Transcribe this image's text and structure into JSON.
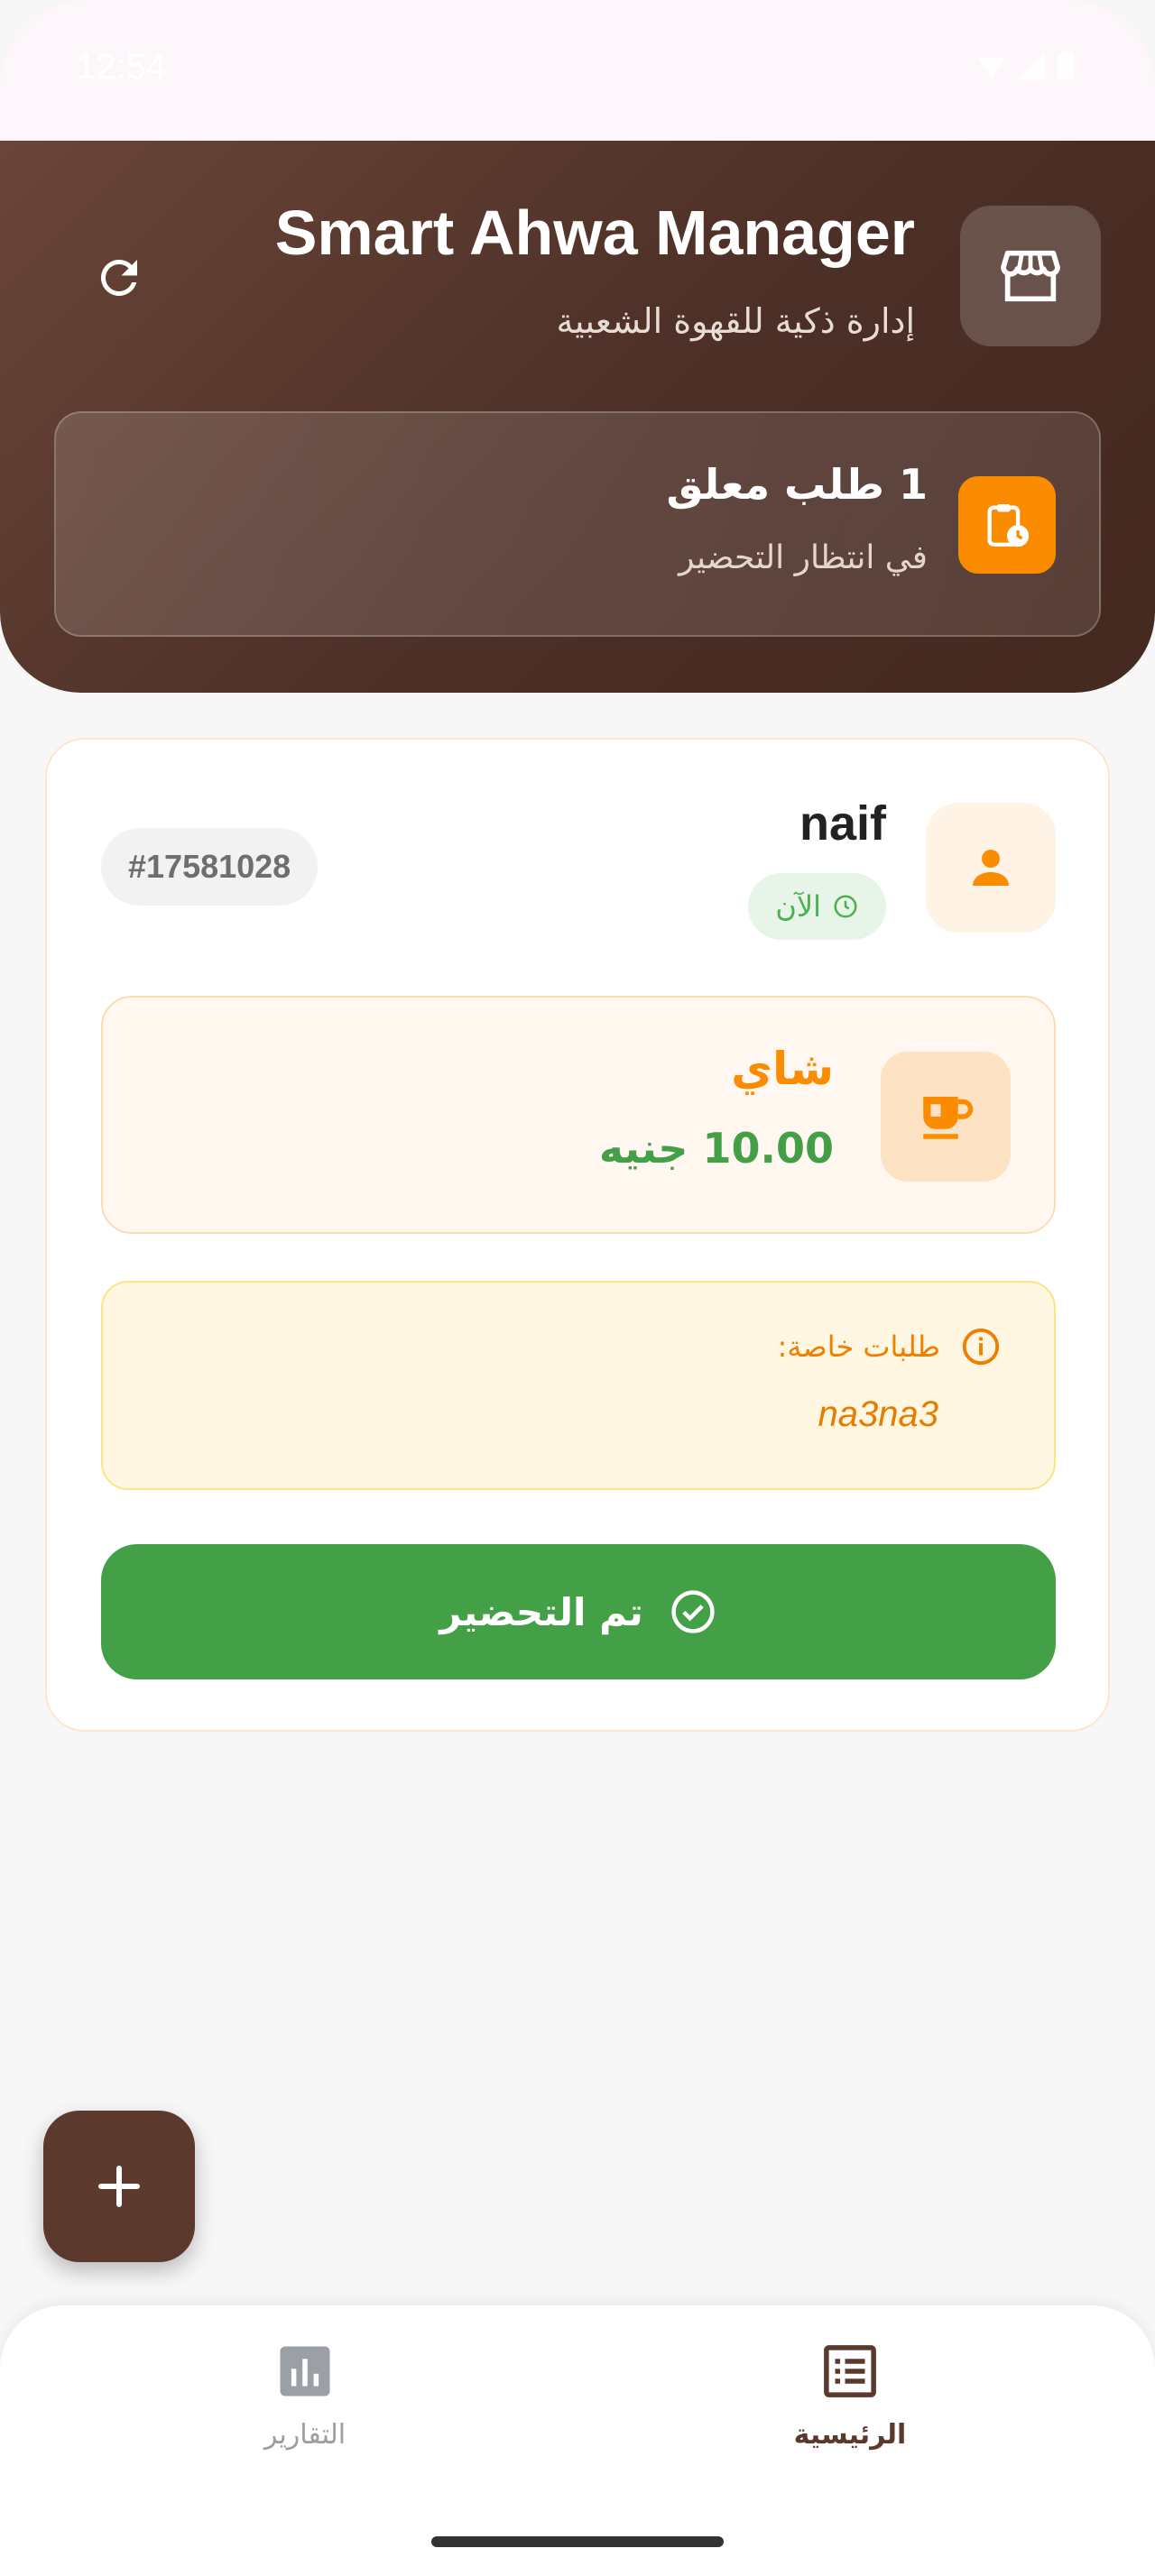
{
  "status_bar": {
    "time": "12:54"
  },
  "header": {
    "title": "Smart Ahwa Manager",
    "subtitle": "إدارة ذكية للقهوة الشعبية",
    "pending": {
      "title": "1 طلب معلق",
      "subtitle": "في انتظار التحضير"
    }
  },
  "order": {
    "customer_name": "naif",
    "time_label": "الآن",
    "order_id": "#17581028",
    "item": {
      "name": "شاي",
      "price": "10.00 جنيه"
    },
    "notes": {
      "label": "طلبات خاصة:",
      "text": "na3na3"
    },
    "done_button_label": "تم التحضير"
  },
  "bottom_nav": {
    "reports_label": "التقارير",
    "home_label": "الرئيسية"
  },
  "colors": {
    "header_brown": "#4c2f27",
    "accent_orange": "#fb8c00",
    "success_green": "#43a047",
    "nav_active": "#5b392d",
    "nav_inactive": "#9e9e9e"
  },
  "icons": {
    "app": "store-icon",
    "refresh": "refresh-icon",
    "pending": "clipboard-clock-icon",
    "customer": "person-icon",
    "time": "clock-icon",
    "item": "tea-cup-icon",
    "notes": "info-icon",
    "done": "check-circle-icon",
    "fab": "plus-icon",
    "reports": "bar-chart-icon",
    "home": "list-icon"
  }
}
